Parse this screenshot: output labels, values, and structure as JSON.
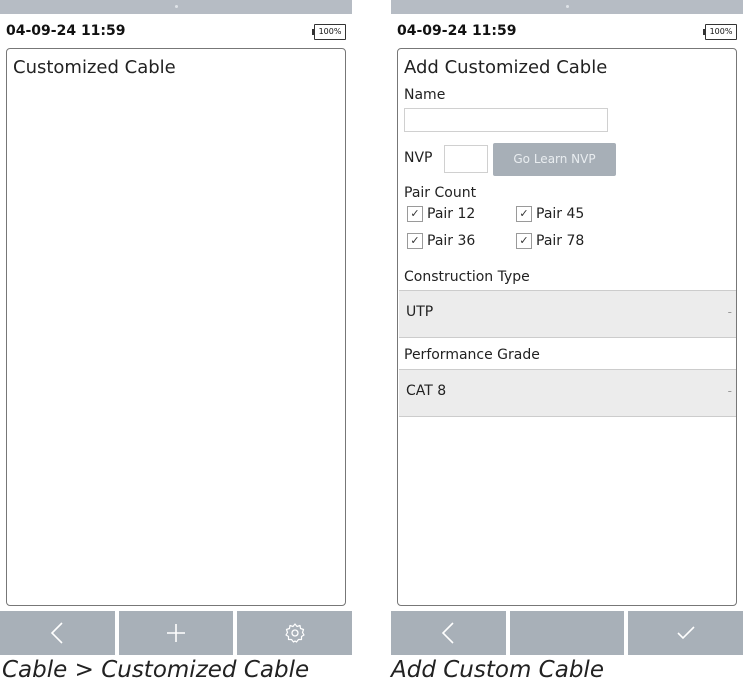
{
  "left": {
    "status": {
      "datetime": "04-09-24 11:59",
      "battery": "100%"
    },
    "panel_title": "Customized Cable",
    "caption": "Cable > Customized Cable"
  },
  "right": {
    "status": {
      "datetime": "04-09-24 11:59",
      "battery": "100%"
    },
    "panel_title": "Add Customized Cable",
    "name_label": "Name",
    "nvp_label": "NVP",
    "learn_button": "Go Learn NVP",
    "pair_count_label": "Pair Count",
    "pairs": [
      {
        "label": "Pair 12",
        "checked": true
      },
      {
        "label": "Pair 45",
        "checked": true
      },
      {
        "label": "Pair 36",
        "checked": true
      },
      {
        "label": "Pair 78",
        "checked": true
      }
    ],
    "construction_label": "Construction Type",
    "construction_value": "UTP",
    "performance_label": "Performance Grade",
    "performance_value": "CAT 8",
    "caption": "Add Custom Cable"
  },
  "icons": {
    "back": "chevron-left-icon",
    "add": "plus-icon",
    "settings": "gear-icon",
    "confirm": "checkmark-icon",
    "dropdown": "chevron-down-icon"
  }
}
